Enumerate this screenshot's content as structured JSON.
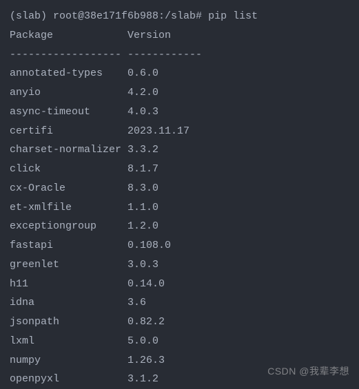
{
  "prompt": {
    "env": "(slab) ",
    "user_host": "root@38e171f6b988",
    "path": ":/slab# ",
    "command": "pip list"
  },
  "header": {
    "package_label": "Package",
    "version_label": "Version"
  },
  "divider": {
    "package_dashes": "------------------",
    "version_dashes": "------------"
  },
  "packages": [
    {
      "name": "annotated-types",
      "version": "0.6.0"
    },
    {
      "name": "anyio",
      "version": "4.2.0"
    },
    {
      "name": "async-timeout",
      "version": "4.0.3"
    },
    {
      "name": "certifi",
      "version": "2023.11.17"
    },
    {
      "name": "charset-normalizer",
      "version": "3.3.2"
    },
    {
      "name": "click",
      "version": "8.1.7"
    },
    {
      "name": "cx-Oracle",
      "version": "8.3.0"
    },
    {
      "name": "et-xmlfile",
      "version": "1.1.0"
    },
    {
      "name": "exceptiongroup",
      "version": "1.2.0"
    },
    {
      "name": "fastapi",
      "version": "0.108.0"
    },
    {
      "name": "greenlet",
      "version": "3.0.3"
    },
    {
      "name": "h11",
      "version": "0.14.0"
    },
    {
      "name": "idna",
      "version": "3.6"
    },
    {
      "name": "jsonpath",
      "version": "0.82.2"
    },
    {
      "name": "lxml",
      "version": "5.0.0"
    },
    {
      "name": "numpy",
      "version": "1.26.3"
    },
    {
      "name": "openpyxl",
      "version": "3.1.2"
    }
  ],
  "watermark": "CSDN @我辈李想"
}
